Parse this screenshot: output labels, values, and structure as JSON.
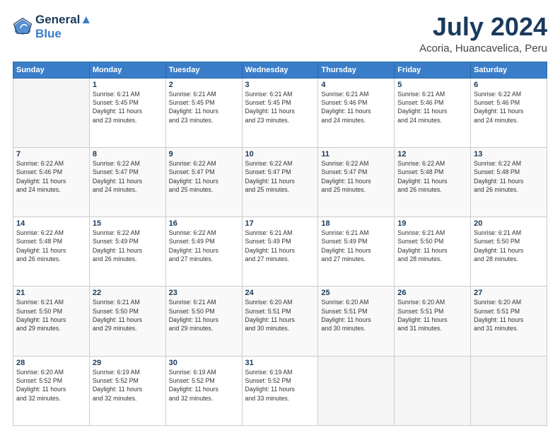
{
  "header": {
    "logo_line1": "General",
    "logo_line2": "Blue",
    "main_title": "July 2024",
    "subtitle": "Acoria, Huancavelica, Peru"
  },
  "columns": [
    "Sunday",
    "Monday",
    "Tuesday",
    "Wednesday",
    "Thursday",
    "Friday",
    "Saturday"
  ],
  "weeks": [
    [
      {
        "day": "",
        "info": ""
      },
      {
        "day": "1",
        "info": "Sunrise: 6:21 AM\nSunset: 5:45 PM\nDaylight: 11 hours\nand 23 minutes."
      },
      {
        "day": "2",
        "info": "Sunrise: 6:21 AM\nSunset: 5:45 PM\nDaylight: 11 hours\nand 23 minutes."
      },
      {
        "day": "3",
        "info": "Sunrise: 6:21 AM\nSunset: 5:45 PM\nDaylight: 11 hours\nand 23 minutes."
      },
      {
        "day": "4",
        "info": "Sunrise: 6:21 AM\nSunset: 5:46 PM\nDaylight: 11 hours\nand 24 minutes."
      },
      {
        "day": "5",
        "info": "Sunrise: 6:21 AM\nSunset: 5:46 PM\nDaylight: 11 hours\nand 24 minutes."
      },
      {
        "day": "6",
        "info": "Sunrise: 6:22 AM\nSunset: 5:46 PM\nDaylight: 11 hours\nand 24 minutes."
      }
    ],
    [
      {
        "day": "7",
        "info": "Sunrise: 6:22 AM\nSunset: 5:46 PM\nDaylight: 11 hours\nand 24 minutes."
      },
      {
        "day": "8",
        "info": "Sunrise: 6:22 AM\nSunset: 5:47 PM\nDaylight: 11 hours\nand 24 minutes."
      },
      {
        "day": "9",
        "info": "Sunrise: 6:22 AM\nSunset: 5:47 PM\nDaylight: 11 hours\nand 25 minutes."
      },
      {
        "day": "10",
        "info": "Sunrise: 6:22 AM\nSunset: 5:47 PM\nDaylight: 11 hours\nand 25 minutes."
      },
      {
        "day": "11",
        "info": "Sunrise: 6:22 AM\nSunset: 5:47 PM\nDaylight: 11 hours\nand 25 minutes."
      },
      {
        "day": "12",
        "info": "Sunrise: 6:22 AM\nSunset: 5:48 PM\nDaylight: 11 hours\nand 26 minutes."
      },
      {
        "day": "13",
        "info": "Sunrise: 6:22 AM\nSunset: 5:48 PM\nDaylight: 11 hours\nand 26 minutes."
      }
    ],
    [
      {
        "day": "14",
        "info": "Sunrise: 6:22 AM\nSunset: 5:48 PM\nDaylight: 11 hours\nand 26 minutes."
      },
      {
        "day": "15",
        "info": "Sunrise: 6:22 AM\nSunset: 5:49 PM\nDaylight: 11 hours\nand 26 minutes."
      },
      {
        "day": "16",
        "info": "Sunrise: 6:22 AM\nSunset: 5:49 PM\nDaylight: 11 hours\nand 27 minutes."
      },
      {
        "day": "17",
        "info": "Sunrise: 6:21 AM\nSunset: 5:49 PM\nDaylight: 11 hours\nand 27 minutes."
      },
      {
        "day": "18",
        "info": "Sunrise: 6:21 AM\nSunset: 5:49 PM\nDaylight: 11 hours\nand 27 minutes."
      },
      {
        "day": "19",
        "info": "Sunrise: 6:21 AM\nSunset: 5:50 PM\nDaylight: 11 hours\nand 28 minutes."
      },
      {
        "day": "20",
        "info": "Sunrise: 6:21 AM\nSunset: 5:50 PM\nDaylight: 11 hours\nand 28 minutes."
      }
    ],
    [
      {
        "day": "21",
        "info": "Sunrise: 6:21 AM\nSunset: 5:50 PM\nDaylight: 11 hours\nand 29 minutes."
      },
      {
        "day": "22",
        "info": "Sunrise: 6:21 AM\nSunset: 5:50 PM\nDaylight: 11 hours\nand 29 minutes."
      },
      {
        "day": "23",
        "info": "Sunrise: 6:21 AM\nSunset: 5:50 PM\nDaylight: 11 hours\nand 29 minutes."
      },
      {
        "day": "24",
        "info": "Sunrise: 6:20 AM\nSunset: 5:51 PM\nDaylight: 11 hours\nand 30 minutes."
      },
      {
        "day": "25",
        "info": "Sunrise: 6:20 AM\nSunset: 5:51 PM\nDaylight: 11 hours\nand 30 minutes."
      },
      {
        "day": "26",
        "info": "Sunrise: 6:20 AM\nSunset: 5:51 PM\nDaylight: 11 hours\nand 31 minutes."
      },
      {
        "day": "27",
        "info": "Sunrise: 6:20 AM\nSunset: 5:51 PM\nDaylight: 11 hours\nand 31 minutes."
      }
    ],
    [
      {
        "day": "28",
        "info": "Sunrise: 6:20 AM\nSunset: 5:52 PM\nDaylight: 11 hours\nand 32 minutes."
      },
      {
        "day": "29",
        "info": "Sunrise: 6:19 AM\nSunset: 5:52 PM\nDaylight: 11 hours\nand 32 minutes."
      },
      {
        "day": "30",
        "info": "Sunrise: 6:19 AM\nSunset: 5:52 PM\nDaylight: 11 hours\nand 32 minutes."
      },
      {
        "day": "31",
        "info": "Sunrise: 6:19 AM\nSunset: 5:52 PM\nDaylight: 11 hours\nand 33 minutes."
      },
      {
        "day": "",
        "info": ""
      },
      {
        "day": "",
        "info": ""
      },
      {
        "day": "",
        "info": ""
      }
    ]
  ]
}
